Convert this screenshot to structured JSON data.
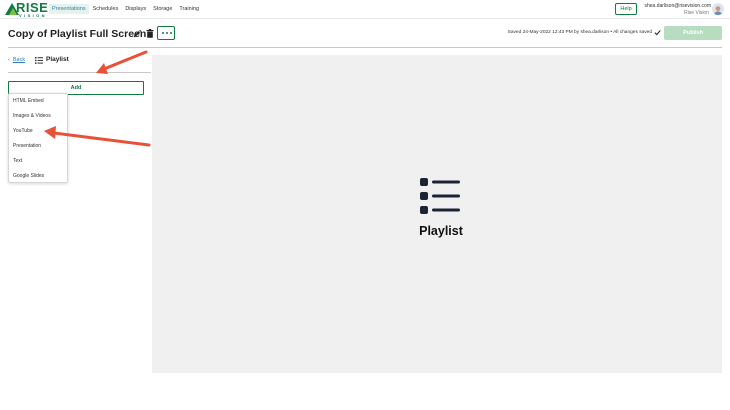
{
  "brand": {
    "logo_text": "RISE",
    "logo_subtext": "VISION",
    "brand_color": "#107c41",
    "link_color": "#2f7fb8"
  },
  "nav": {
    "items": [
      {
        "label": "Presentations",
        "active": true
      },
      {
        "label": "Schedules",
        "active": false
      },
      {
        "label": "Displays",
        "active": false
      },
      {
        "label": "Storage",
        "active": false
      },
      {
        "label": "Training",
        "active": false
      }
    ],
    "help_label": "Help",
    "user_email": "shea.darlison@risevision.com",
    "user_org": "Rise Vision"
  },
  "editor": {
    "title": "Copy of Playlist Full Screen",
    "saved_status": "Saved 24-May-2022 12:43 PM by shea.darlison • All changes saved",
    "publish_label": "Publish",
    "icons": [
      "pencil-icon",
      "trash-icon",
      "more-icon",
      "check-icon"
    ]
  },
  "panel": {
    "back_label": "Back",
    "section_label": "Playlist",
    "add_label": "Add",
    "menu_items": [
      "HTML Embed",
      "Images & Videos",
      "YouTube",
      "Presentation",
      "Text",
      "Google Slides"
    ]
  },
  "canvas": {
    "label": "Playlist",
    "background": "#f0f0f0"
  },
  "annotations": {
    "arrow_color": "#e8503a"
  }
}
